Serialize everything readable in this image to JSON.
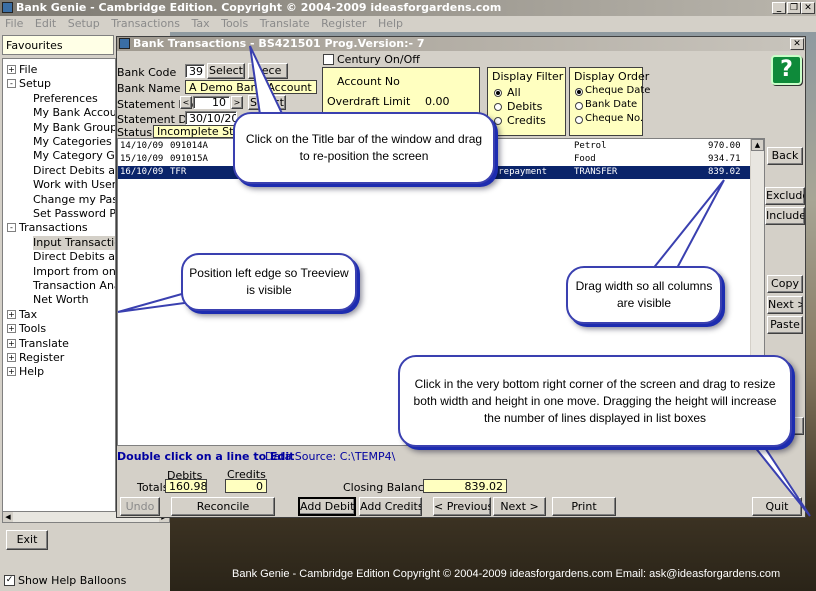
{
  "app": {
    "title": "Bank Genie  - Cambridge Edition. Copyright © 2004-2009 ideasforgardens.com",
    "menu": [
      "File",
      "Edit",
      "Setup",
      "Transactions",
      "Tax",
      "Tools",
      "Translate",
      "Register",
      "Help"
    ]
  },
  "sidebar": {
    "favourites": "Favourites",
    "tree": [
      {
        "label": "File",
        "level": 0,
        "toggle": "+"
      },
      {
        "label": "Setup",
        "level": 0,
        "toggle": "-"
      },
      {
        "label": "Preferences",
        "level": 1
      },
      {
        "label": "My Bank Accounts",
        "level": 1
      },
      {
        "label": "My Bank Groups",
        "level": 1
      },
      {
        "label": "My Categories",
        "level": 1
      },
      {
        "label": "My Category Groups",
        "level": 1
      },
      {
        "label": "Direct Debits and",
        "level": 1
      },
      {
        "label": "Work with User Pr",
        "level": 1
      },
      {
        "label": "Change my Passw",
        "level": 1
      },
      {
        "label": "Set Password Pro",
        "level": 1
      },
      {
        "label": "Transactions",
        "level": 0,
        "toggle": "-"
      },
      {
        "label": "Input Transactions",
        "level": 1,
        "selected": true
      },
      {
        "label": "Direct Debits and",
        "level": 1
      },
      {
        "label": "Import from on-lin",
        "level": 1
      },
      {
        "label": "Transaction Analy",
        "level": 1
      },
      {
        "label": "Net Worth",
        "level": 1
      },
      {
        "label": "Tax",
        "level": 0,
        "toggle": "+"
      },
      {
        "label": "Tools",
        "level": 0,
        "toggle": "+"
      },
      {
        "label": "Translate",
        "level": 0,
        "toggle": "+"
      },
      {
        "label": "Register",
        "level": 0,
        "toggle": "+"
      },
      {
        "label": "Help",
        "level": 0,
        "toggle": "+"
      }
    ],
    "exit_label": "Exit",
    "show_help_label": "Show Help Balloons",
    "show_help_checked": true
  },
  "window": {
    "title": "Bank Transactions - BS421501   Prog.Version:- 7",
    "bank_code_label": "Bank Code",
    "bank_code": "39",
    "select_label": "Select",
    "recent_label": "Rece",
    "bank_name_label": "Bank Name",
    "bank_name": "A Demo Bank Account",
    "statement_no_label": "Statement No",
    "statement_no": "10",
    "statement_select_label": "Select",
    "statement_date_label": "Statement Date",
    "statement_date": "30/10/2009",
    "status_label": "Status",
    "status": "Incomplete Statement",
    "century_label": "Century On/Off",
    "account_no_label": "Account No",
    "overdraft_label": "Overdraft Limit",
    "overdraft_value": "0.00",
    "filter": {
      "title": "Display Filter",
      "options": [
        "All",
        "Debits",
        "Credits"
      ],
      "selected": "All"
    },
    "order": {
      "title": "Display Order",
      "options": [
        "Cheque Date",
        "Bank Date",
        "Cheque No."
      ],
      "selected": "Cheque Date"
    },
    "rows": [
      {
        "date": "14/10/09",
        "ref": "091014A",
        "desc": "",
        "cat": "Petrol",
        "amount": "970.00",
        "selected": false
      },
      {
        "date": "15/10/09",
        "ref": "091015A",
        "desc": "ss",
        "cat": "Food",
        "amount": "934.71",
        "selected": false
      },
      {
        "date": "16/10/09",
        "ref": "TFR",
        "desc": "ll repayment",
        "cat": "TRANSFER",
        "amount": "839.02",
        "selected": true
      }
    ],
    "hint": "Double click on a line to Edit",
    "data_source": "Data Source: C:\\TEMP4\\",
    "debits_label": "Debits",
    "credits_label": "Credits",
    "totals_label": "Totals",
    "debits_total": "160.98",
    "credits_total": "0",
    "closing_label": "Closing Balance",
    "closing_value": "839.02"
  },
  "right_buttons": [
    "Back",
    "Exclude",
    "Include",
    "Copy",
    "Next >",
    "Paste"
  ],
  "bottom_buttons": {
    "undo": "Undo",
    "reconcile": "Reconcile",
    "add_debits": "Add Debits",
    "add_credits": "Add Credits",
    "previous": "< Previous",
    "next": "Next >",
    "print": "Print",
    "quit": "Quit"
  },
  "help_icon": "question-icon",
  "balloons": {
    "title_bar": "Click on the Title bar of the window and drag to re-position the screen",
    "left_edge": "Position left edge so Treeview is visible",
    "width": "Drag width so all columns are visible",
    "corner": "Click in the very bottom right corner of the screen and drag to resize both width and height in one move. Dragging the height will increase the number of lines displayed in list boxes"
  },
  "footer": "Bank Genie - Cambridge Edition    Copyright © 2004-2009 ideasforgardens.com    Email:  ask@ideasforgardens.com"
}
